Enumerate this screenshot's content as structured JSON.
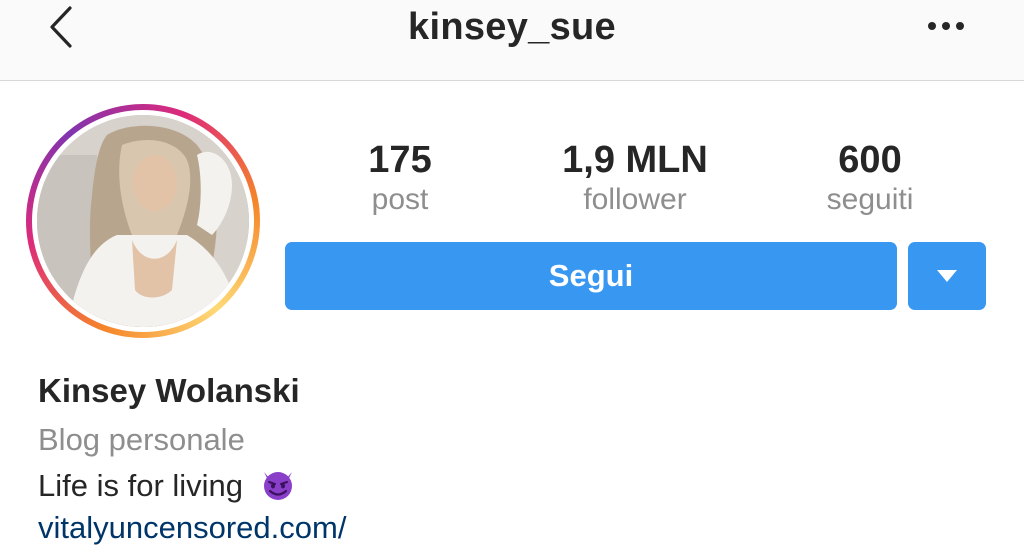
{
  "header": {
    "username": "kinsey_sue",
    "back_icon": "chevron-left-icon",
    "more_icon": "more-horizontal-icon"
  },
  "profile": {
    "avatar": "profile-photo",
    "stats": [
      {
        "value": "175",
        "label": "post"
      },
      {
        "value": "1,9 MLN",
        "label": "follower"
      },
      {
        "value": "600",
        "label": "seguiti"
      }
    ],
    "follow_label": "Segui",
    "dropdown_icon": "triangle-down-icon",
    "full_name": "Kinsey Wolanski",
    "category": "Blog personale",
    "bio": "Life is for living",
    "bio_emoji": "smiling-devil-emoji",
    "website": "vitalyuncensored.com/"
  },
  "colors": {
    "accent": "#3897f0",
    "link": "#003569",
    "muted": "#8e8e8e",
    "text": "#262626"
  }
}
